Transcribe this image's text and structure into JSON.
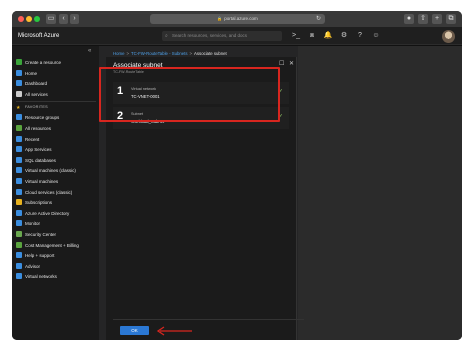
{
  "browser": {
    "url": "portal.azure.com",
    "lock_glyph": "🔒",
    "reload_glyph": "↻",
    "back_glyph": "‹",
    "forward_glyph": "›"
  },
  "topbar": {
    "brand": "Microsoft Azure",
    "search_placeholder": "Search resources, services, and docs"
  },
  "sidebar": {
    "collapse_glyph": "«",
    "items": [
      {
        "label": "Create a resource",
        "color": "#3aa53a"
      },
      {
        "label": "Home",
        "color": "#3b8ee0"
      },
      {
        "label": "Dashboard",
        "color": "#3b8ee0"
      },
      {
        "label": "All services",
        "color": "#cccccc"
      },
      {
        "label": "FAVORITES",
        "heading": true
      },
      {
        "label": "Resource groups",
        "color": "#3b8ee0"
      },
      {
        "label": "All resources",
        "color": "#5aa43e"
      },
      {
        "label": "Recent",
        "color": "#3b8ee0"
      },
      {
        "label": "App Services",
        "color": "#3b8ee0"
      },
      {
        "label": "SQL databases",
        "color": "#3b8ee0"
      },
      {
        "label": "Virtual machines (classic)",
        "color": "#3b8ee0"
      },
      {
        "label": "Virtual machines",
        "color": "#3b8ee0"
      },
      {
        "label": "Cloud services (classic)",
        "color": "#3b8ee0"
      },
      {
        "label": "Subscriptions",
        "color": "#e8b21e"
      },
      {
        "label": "Azure Active Directory",
        "color": "#3b8ee0"
      },
      {
        "label": "Monitor",
        "color": "#3b8ee0"
      },
      {
        "label": "Security Center",
        "color": "#6aa84f"
      },
      {
        "label": "Cost Management + Billing",
        "color": "#5aa43e"
      },
      {
        "label": "Help + support",
        "color": "#3b8ee0"
      },
      {
        "label": "Advisor",
        "color": "#3b8ee0"
      },
      {
        "label": "Virtual networks",
        "color": "#3b8ee0"
      }
    ]
  },
  "breadcrumb": {
    "items": [
      "Home",
      "TC-FW-RouteTable - Subnets"
    ],
    "current": "Associate subnet",
    "separator": ">"
  },
  "blade": {
    "title": "Associate subnet",
    "subtitle": "TC-FW-RouteTable",
    "maximize_glyph": "☐",
    "close_glyph": "✕",
    "fields": [
      {
        "number": "1",
        "label": "Virtual network",
        "value": "TC-VNET-0001",
        "check": "✓"
      },
      {
        "number": "2",
        "label": "Subnet",
        "value": "Workload_Subnet",
        "check": "✓"
      }
    ],
    "ok_label": "OK"
  },
  "colors": {
    "highlight": "#d8261f",
    "primary": "#2b78d4",
    "check": "#9bd46a"
  }
}
